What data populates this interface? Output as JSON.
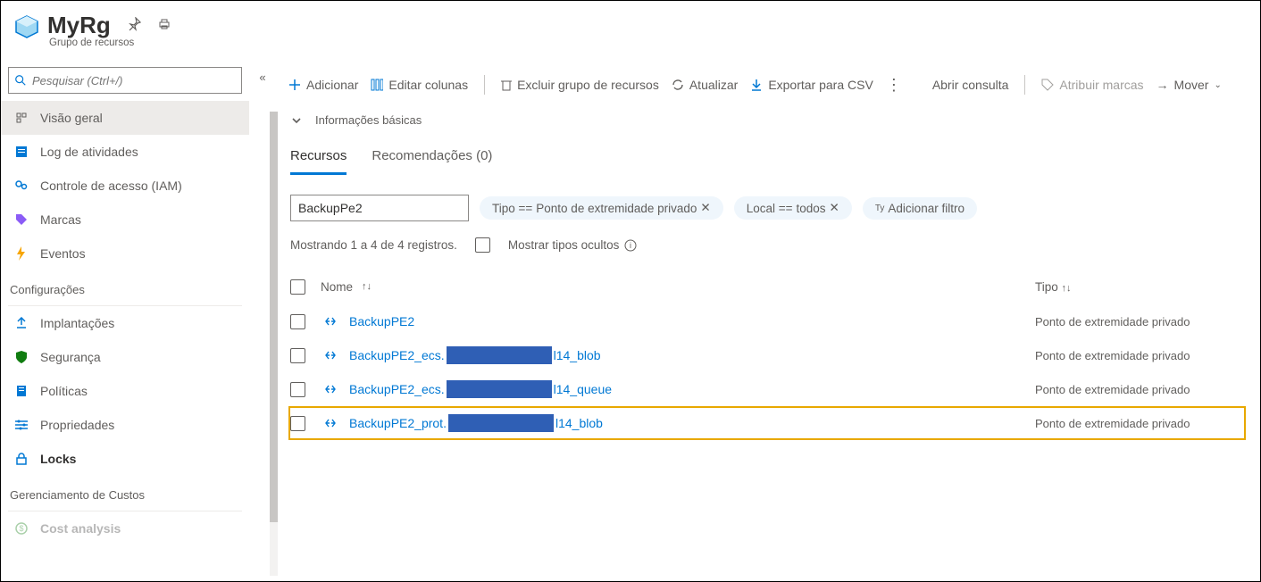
{
  "header": {
    "title": "MyRg",
    "subtitle": "Grupo de recursos"
  },
  "sidebar": {
    "search_placeholder": "Pesquisar (Ctrl+/)",
    "items_top": [
      {
        "id": "overview",
        "label": "Visão geral"
      },
      {
        "id": "activity",
        "label": "Log de atividades"
      },
      {
        "id": "iam",
        "label": "Controle de acesso (IAM)"
      },
      {
        "id": "tags",
        "label": "Marcas"
      },
      {
        "id": "events",
        "label": "Eventos"
      }
    ],
    "section_settings": "Configurações",
    "items_settings": [
      {
        "id": "deployments",
        "label": "Implantações"
      },
      {
        "id": "security",
        "label": "Segurança"
      },
      {
        "id": "policies",
        "label": "Políticas"
      },
      {
        "id": "properties",
        "label": "Propriedades"
      },
      {
        "id": "locks",
        "label": "Locks"
      }
    ],
    "section_cost": "Gerenciamento de Custos",
    "items_cost": [
      {
        "id": "costanalysis",
        "label": "Cost analysis"
      }
    ]
  },
  "toolbar": {
    "add": "Adicionar",
    "edit_columns": "Editar colunas",
    "delete_rg": "Excluir grupo de recursos",
    "refresh": "Atualizar",
    "export_csv": "Exportar para CSV",
    "open_query": "Abrir consulta",
    "assign_tags": "Atribuir marcas",
    "move": "Mover"
  },
  "infobar": {
    "label": "Informações básicas"
  },
  "tabs": {
    "resources": "Recursos",
    "recommendations": "Recomendações (0)"
  },
  "filters": {
    "input_value": "BackupPe2",
    "type_pill_label": "Tipo ==",
    "type_pill_value": "Ponto de extremidade privado",
    "location_pill_label": "Local ==",
    "location_pill_value": "todos",
    "add_filter": "Adicionar filtro",
    "add_filter_prefix": "Ty"
  },
  "meta": {
    "showing": "Mostrando 1 a 4 de 4 registros.",
    "show_hidden": "Mostrar tipos ocultos"
  },
  "columns": {
    "name": "Nome",
    "name_sort": "↑↓",
    "type": "Tipo",
    "type_sort": "↑↓"
  },
  "rows": [
    {
      "name": "BackupPE2",
      "suffix": "",
      "type": "Ponto de extremidade privado",
      "highlight": false,
      "redact": false
    },
    {
      "name": "BackupPE2_ecs.",
      "suffix": "l14_blob",
      "type": "Ponto de extremidade privado",
      "highlight": false,
      "redact": true
    },
    {
      "name": "BackupPE2_ecs.",
      "suffix": "l14_queue",
      "type": "Ponto de extremidade privado",
      "highlight": false,
      "redact": true
    },
    {
      "name": "BackupPE2_prot.",
      "suffix": "l14_blob",
      "type": "Ponto de extremidade privado",
      "highlight": true,
      "redact": true
    }
  ]
}
